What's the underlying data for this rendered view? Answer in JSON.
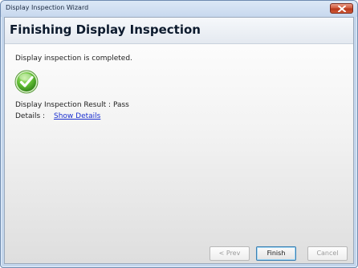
{
  "window": {
    "title": "Display Inspection Wizard",
    "close_icon": "close-x-icon"
  },
  "header": {
    "title": "Finishing Display Inspection"
  },
  "content": {
    "status_message": "Display inspection is completed.",
    "status_icon": "success-checkmark-icon",
    "result_text": "Display Inspection Result : Pass",
    "details_label": "Details :",
    "details_link": "Show Details"
  },
  "buttons": {
    "prev": "< Prev",
    "finish": "Finish",
    "cancel": "Cancel"
  },
  "colors": {
    "link": "#1a2fd0",
    "success": "#4fae2c",
    "close_button": "#c9452a"
  }
}
